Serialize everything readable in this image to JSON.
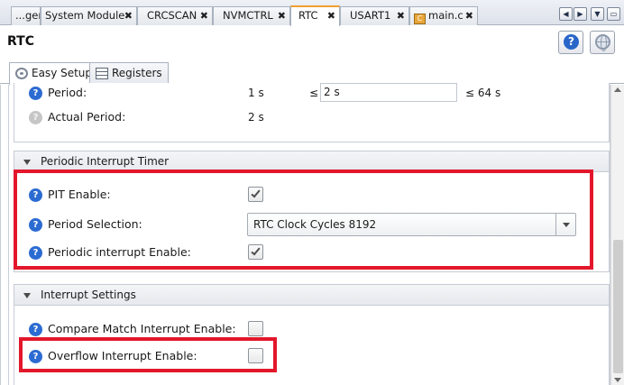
{
  "tabs": [
    {
      "label": "...ger",
      "active": false
    },
    {
      "label": "System Module",
      "active": false
    },
    {
      "label": "CRCSCAN",
      "active": false
    },
    {
      "label": "NVMCTRL",
      "active": false
    },
    {
      "label": "RTC",
      "active": true
    },
    {
      "label": "USART1",
      "active": false
    },
    {
      "label": "main.c",
      "active": false
    }
  ],
  "tab_close_glyph": "✖",
  "nav_buttons": {
    "left": "◀",
    "right": "▶",
    "down": "▼",
    "restore": "▭"
  },
  "header": {
    "title": "RTC",
    "help_glyph": "?"
  },
  "subtabs": [
    {
      "label": "Easy Setup",
      "icon": "gear-icon",
      "active": true
    },
    {
      "label": "Registers",
      "icon": "registers-icon",
      "active": false
    }
  ],
  "rtc_section": {
    "period": {
      "label": "Period:",
      "min": "1 s",
      "op": "≤",
      "value": "2 s",
      "max": "≤ 64 s"
    },
    "actual_period": {
      "label": "Actual Period:",
      "value": "2 s"
    }
  },
  "pit_section": {
    "title": "Periodic Interrupt Timer",
    "pit_enable": {
      "label": "PIT Enable:",
      "checked": true
    },
    "period_selection": {
      "label": "Period Selection:",
      "value": "RTC Clock Cycles 8192"
    },
    "periodic_interrupt_enable": {
      "label": "Periodic interrupt Enable:",
      "checked": true
    }
  },
  "interrupt_section": {
    "title": "Interrupt Settings",
    "compare_match": {
      "label": "Compare Match Interrupt Enable:",
      "checked": false
    },
    "overflow": {
      "label": "Overflow Interrupt Enable:",
      "checked": false
    }
  },
  "highlight_color": "#e3172b",
  "accent_color": "#2c6bd1"
}
